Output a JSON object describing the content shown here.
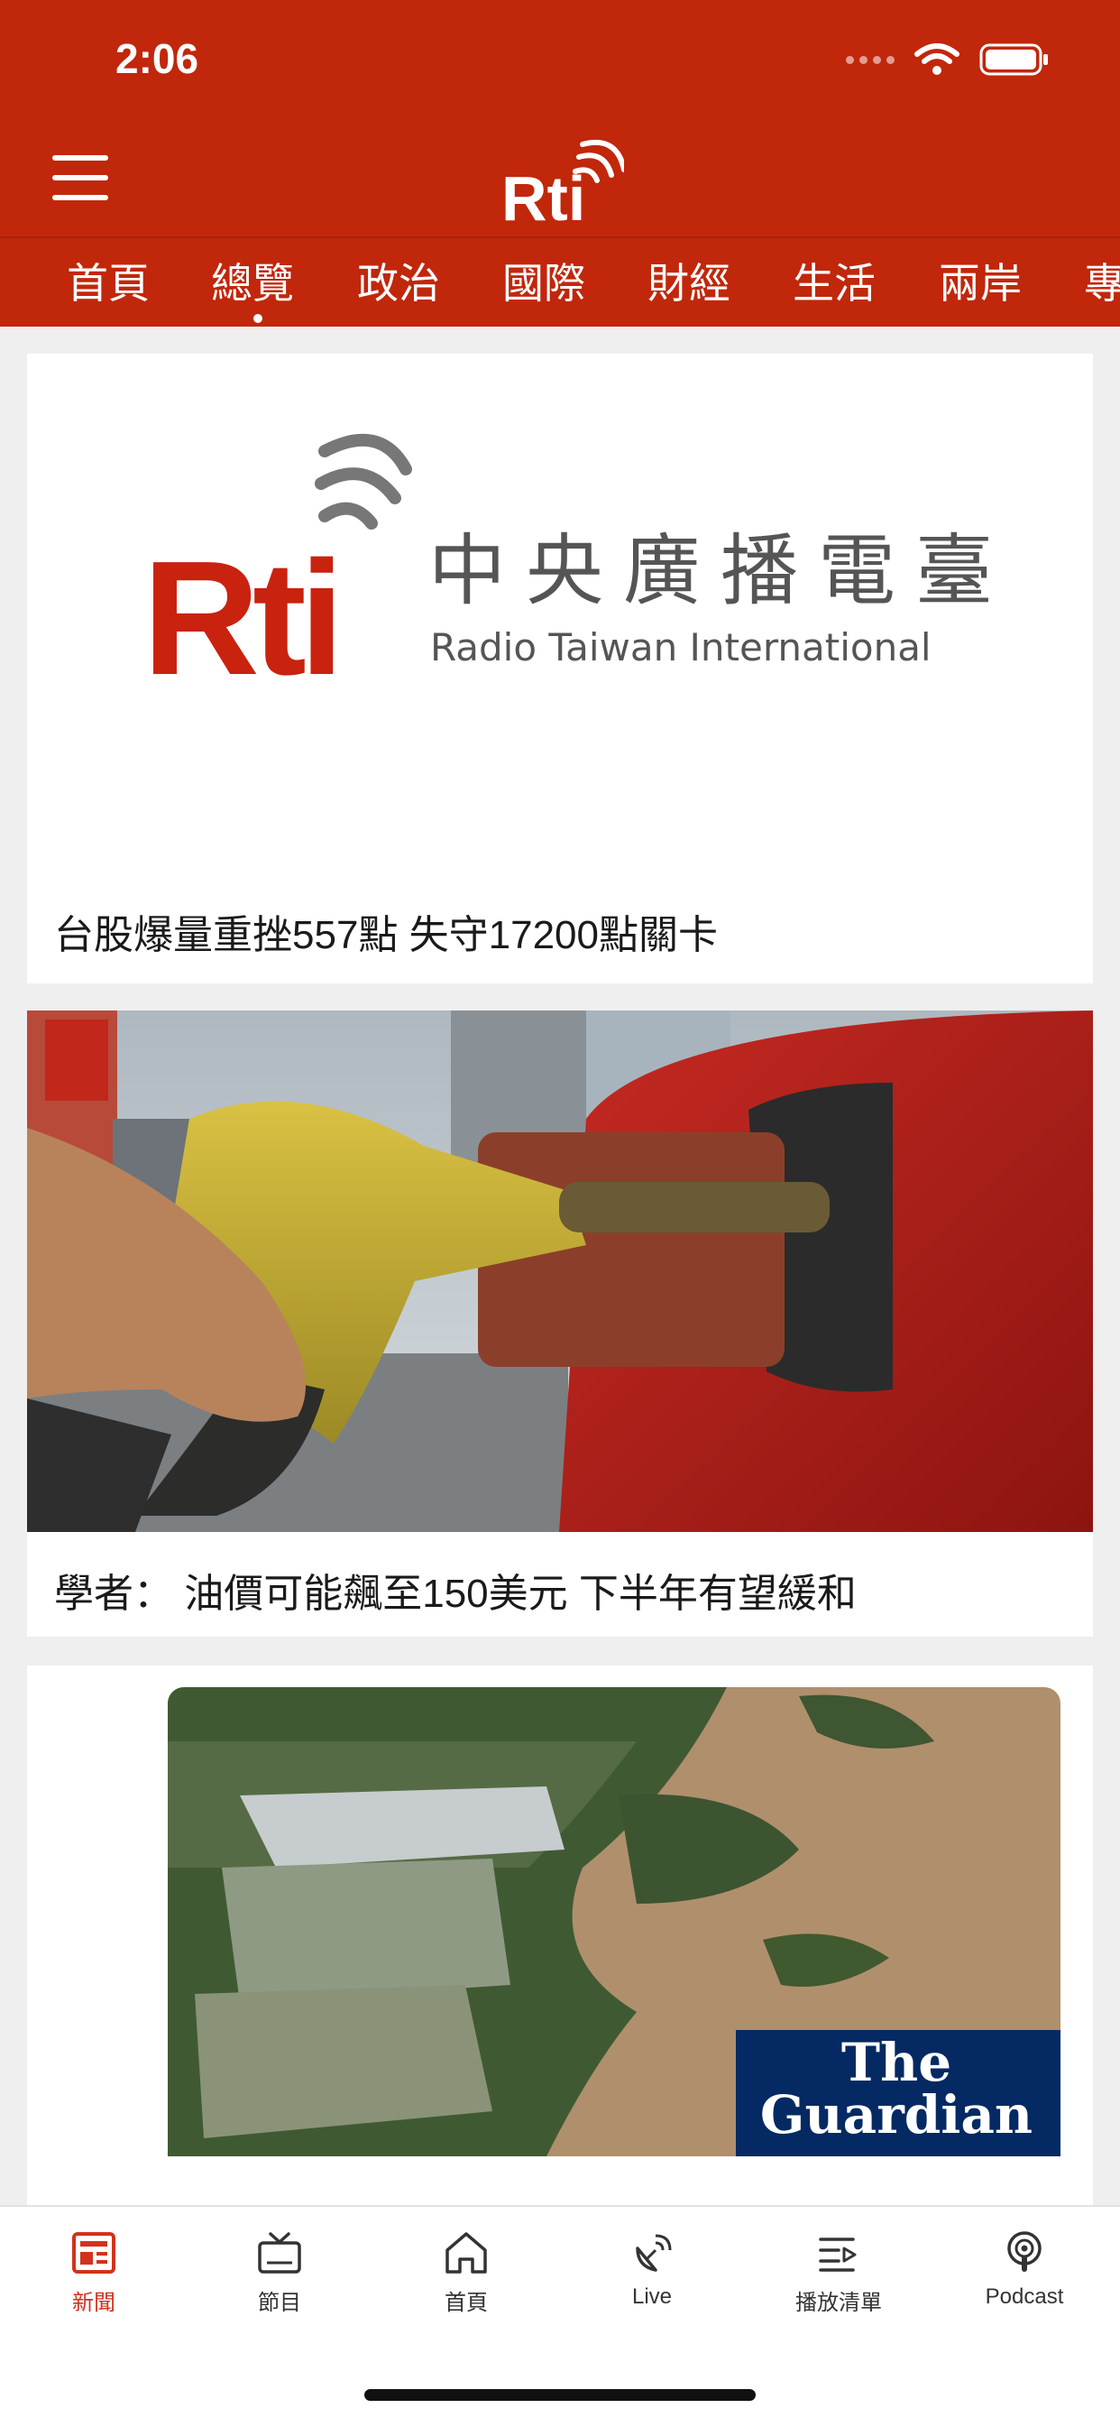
{
  "status_bar": {
    "time": "2:06"
  },
  "header": {
    "logo_text": "Rti",
    "categories": [
      "首頁",
      "總覽",
      "政治",
      "國際",
      "財經",
      "生活",
      "兩岸",
      "專"
    ],
    "active_category": "總覽"
  },
  "articles": [
    {
      "title": "台股爆量重挫557點  失守17200點關卡",
      "image": {
        "logo_text": "Rti",
        "brand_name_zh": "中央廣播電臺",
        "brand_name_en": "Radio Taiwan International"
      }
    },
    {
      "title": "學者：  油價可能飆至150美元 下半年有望緩和",
      "image": {
        "description_icon": "fuel-nozzle-photo"
      }
    },
    {
      "title": "",
      "image": {
        "watermark_line1": "The",
        "watermark_line2": "Guardian"
      }
    }
  ],
  "tab_bar": {
    "items": [
      {
        "label": "新聞",
        "icon": "news-icon",
        "active": true
      },
      {
        "label": "節目",
        "icon": "tv-icon",
        "active": false
      },
      {
        "label": "首頁",
        "icon": "home-icon",
        "active": false
      },
      {
        "label": "Live",
        "icon": "live-antenna-icon",
        "active": false
      },
      {
        "label": "播放清單",
        "icon": "playlist-icon",
        "active": false
      },
      {
        "label": "Podcast",
        "icon": "podcast-icon",
        "active": false
      }
    ]
  },
  "colors": {
    "brand_red": "#c1270b",
    "active_tab": "#d2321c",
    "guardian_blue": "#052962"
  }
}
